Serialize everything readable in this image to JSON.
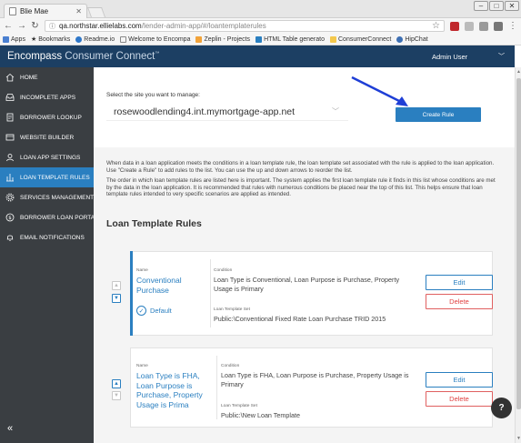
{
  "browser": {
    "tab_title": "Blie Mae",
    "url_host": "qa.northstar.ellielabs.com",
    "url_path": "/lender-admin-app/#/loantemplaterules",
    "bookmarks": [
      "Apps",
      "Bookmarks",
      "Readme.io",
      "Welcome to Encompa",
      "Zeplin - Projects",
      "HTML Table generato",
      "ConsumerConnect",
      "HipChat"
    ]
  },
  "header": {
    "brand_main": "Encompass",
    "brand_sub": "Consumer Connect",
    "brand_tm": "™",
    "user": "Admin User"
  },
  "sidebar": {
    "items": [
      {
        "label": "HOME",
        "icon": "home-icon"
      },
      {
        "label": "INCOMPLETE APPS",
        "icon": "inbox-icon"
      },
      {
        "label": "BORROWER LOOKUP",
        "icon": "document-icon"
      },
      {
        "label": "WEBSITE BUILDER",
        "icon": "layout-icon"
      },
      {
        "label": "LOAN APP SETTINGS",
        "icon": "user-settings-icon"
      },
      {
        "label": "LOAN TEMPLATE RULES",
        "icon": "rules-icon"
      },
      {
        "label": "SERVICES MANAGEMENT",
        "icon": "gear-icon"
      },
      {
        "label": "BORROWER LOAN PORTAL",
        "icon": "dollar-icon"
      },
      {
        "label": "EMAIL NOTIFICATIONS",
        "icon": "bell-icon"
      }
    ],
    "active_index": 5,
    "collapse_label": "«"
  },
  "site": {
    "label": "Select the site you want to manage:",
    "value": "rosewoodlending4.int.mymortgage-app.net",
    "create_button": "Create Rule"
  },
  "description": {
    "p1": "When data in a loan application meets the conditions in a loan template rule, the loan template set associated with the rule is applied to the loan application. Use \"Create a Rule\" to add rules to the list. You can use the up and down arrows to reorder the list.",
    "p2": "The order in which loan template rules are listed here is important. The system applies the first loan template rule it finds in this list whose conditions are met by the data in the loan application. It is recommended that rules with numerous conditions be placed near the top of this list. This helps ensure that loan template rules intended to very specific scenarios are applied as intended."
  },
  "rules_section_title": "Loan Template Rules",
  "labels": {
    "name": "Name",
    "condition": "Condition",
    "template_set": "Loan Template Set",
    "edit": "Edit",
    "delete": "Delete",
    "default": "Default"
  },
  "rules": [
    {
      "name": "Conventional Purchase",
      "condition": "Loan Type is Conventional, Loan Purpose is Purchase, Property Usage is Primary",
      "template_set": "Public:\\Conventional Fixed Rate Loan Purchase TRID 2015",
      "is_default": true
    },
    {
      "name": "Loan Type is FHA, Loan Purpose is Purchase, Property Usage is Prima",
      "condition": "Loan Type is FHA, Loan Purpose is Purchase, Property Usage is Primary",
      "template_set": "Public:\\New Loan Template",
      "is_default": false
    }
  ],
  "help_label": "?"
}
